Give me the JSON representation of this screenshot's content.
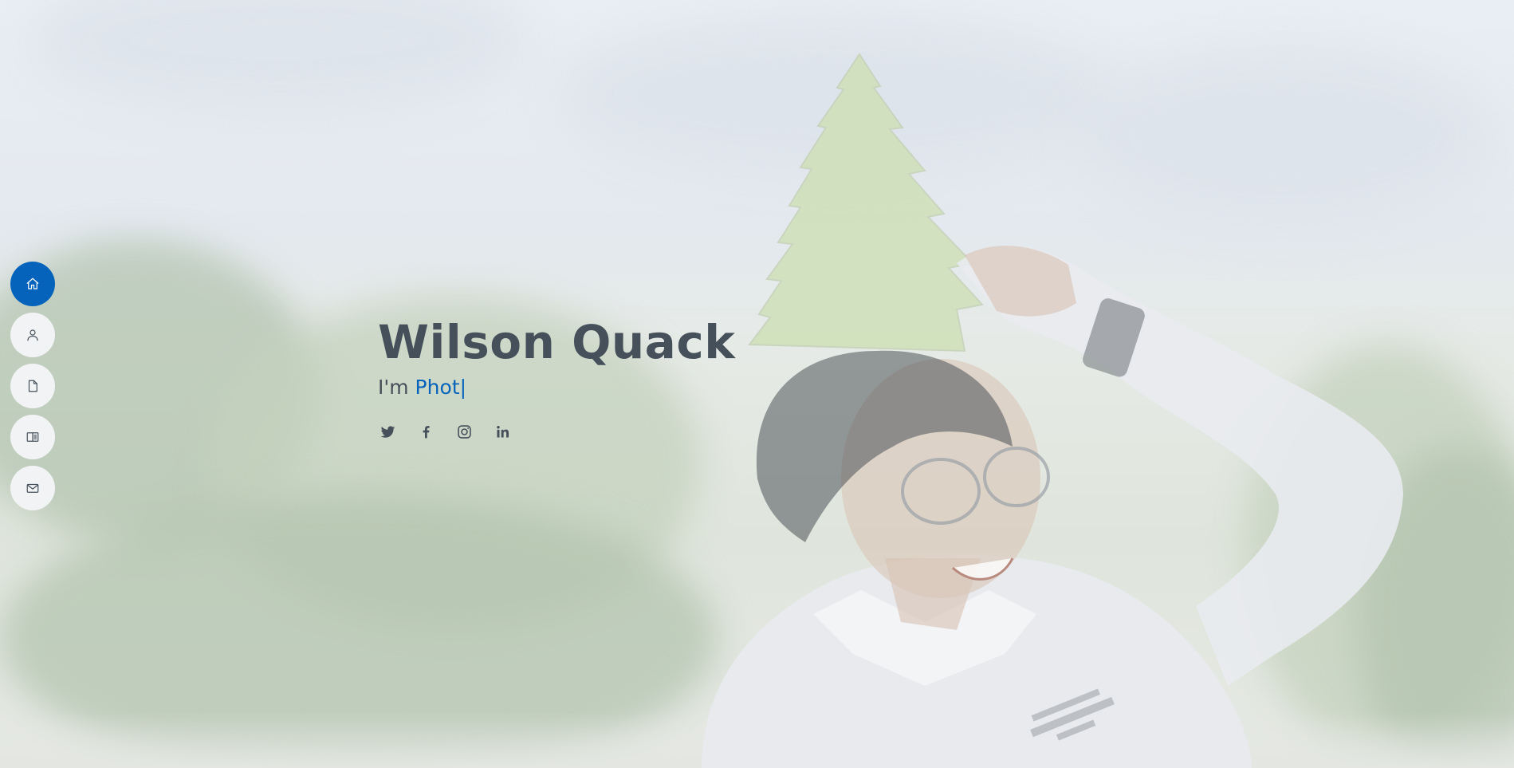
{
  "hero": {
    "name": "Wilson Quack",
    "prefix": "I'm ",
    "typed_text": "Phot",
    "cursor": "|"
  },
  "nav": {
    "items": [
      {
        "icon": "home-icon",
        "active": true
      },
      {
        "icon": "person-icon",
        "active": false
      },
      {
        "icon": "file-icon",
        "active": false
      },
      {
        "icon": "book-icon",
        "active": false
      },
      {
        "icon": "envelope-icon",
        "active": false
      }
    ]
  },
  "social": {
    "items": [
      {
        "icon": "twitter-icon"
      },
      {
        "icon": "facebook-icon"
      },
      {
        "icon": "instagram-icon"
      },
      {
        "icon": "linkedin-icon"
      }
    ]
  },
  "theme": {
    "accent": "#0563bb",
    "text": "#45505b",
    "nav_bg": "#f2f3f5"
  }
}
